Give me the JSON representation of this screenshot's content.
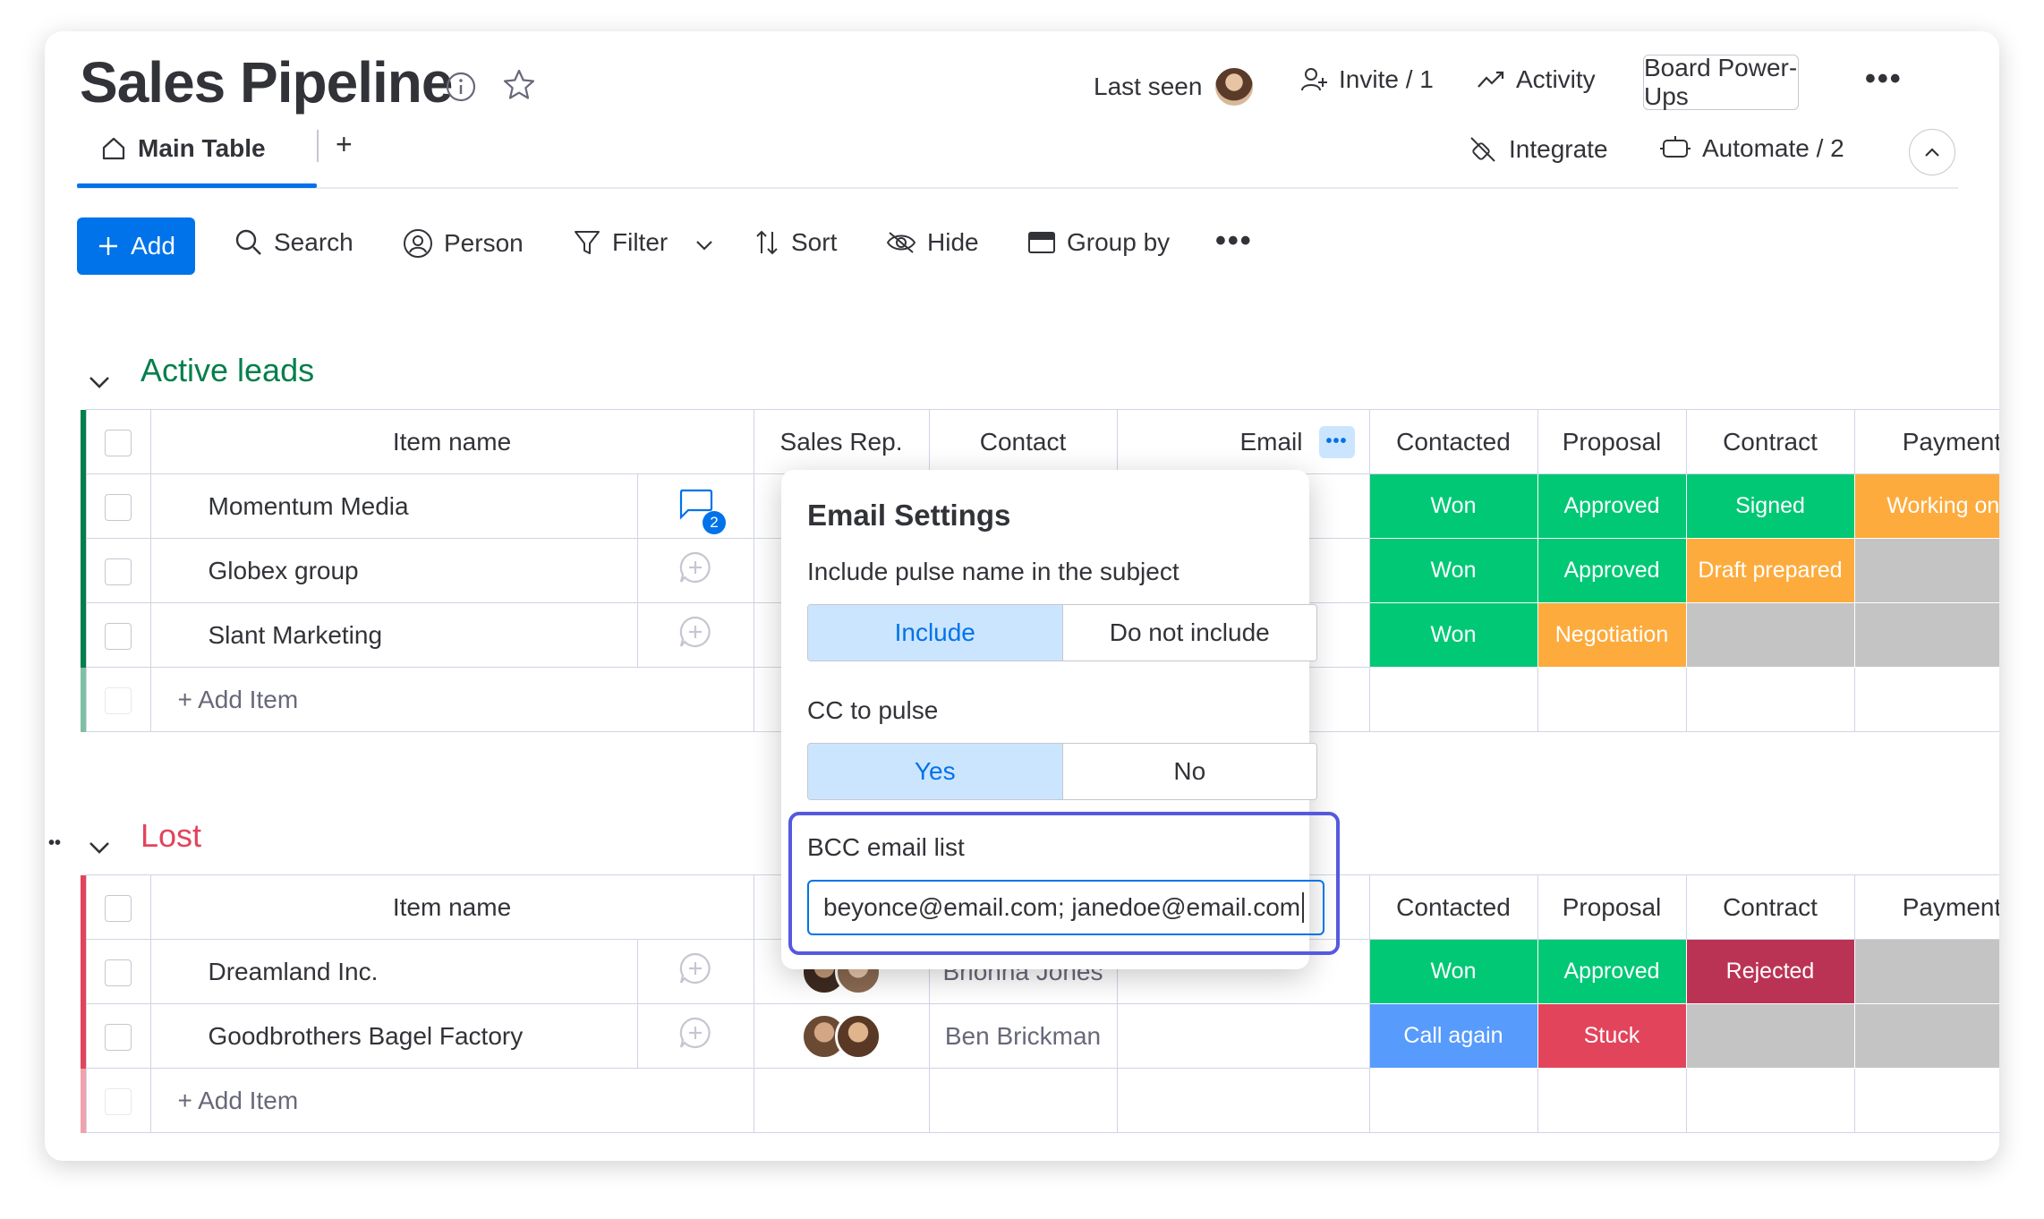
{
  "header": {
    "title": "Sales Pipeline",
    "last_seen": "Last seen",
    "invite": "Invite / 1",
    "activity": "Activity",
    "power_ups": "Board Power-Ups",
    "integrate": "Integrate",
    "automate": "Automate / 2"
  },
  "tabs": {
    "main": "Main Table",
    "add": "+"
  },
  "toolbar": {
    "add": "Add",
    "search": "Search",
    "person": "Person",
    "filter": "Filter",
    "sort": "Sort",
    "hide": "Hide",
    "group_by": "Group by"
  },
  "colors": {
    "accent": "#0073ea",
    "won": "#00c875",
    "orange": "#fdab3d",
    "empty": "#c4c4c4",
    "rejected": "#bb3354",
    "stuck": "#e2445c",
    "call_again": "#579bfc",
    "active_group": "#037f4c",
    "lost_group": "#e2445c"
  },
  "columns": {
    "item_name": "Item name",
    "sales_rep": "Sales Rep.",
    "contact": "Contact",
    "email": "Email",
    "contacted": "Contacted",
    "proposal": "Proposal",
    "contract": "Contract",
    "payment": "Payment"
  },
  "groups": {
    "active": {
      "title": "Active leads",
      "add_item": "+ Add Item",
      "rows": [
        {
          "name": "Momentum Media",
          "updates_count": "2",
          "contacted": "Won",
          "proposal": "Approved",
          "contract": "Signed",
          "payment": "Working on it"
        },
        {
          "name": "Globex group",
          "contacted": "Won",
          "proposal": "Approved",
          "contract": "Draft prepared",
          "payment": ""
        },
        {
          "name": "Slant Marketing",
          "contacted": "Won",
          "proposal": "Negotiation",
          "contract": "",
          "payment": ""
        }
      ]
    },
    "lost": {
      "title": "Lost",
      "add_item": "+ Add Item",
      "rows": [
        {
          "name": "Dreamland Inc.",
          "contact": "Brionna Jones",
          "contacted": "Won",
          "proposal": "Approved",
          "contract": "Rejected",
          "payment": ""
        },
        {
          "name": "Goodbrothers Bagel Factory",
          "contact": "Ben Brickman",
          "contacted": "Call again",
          "proposal": "Stuck",
          "contract": "",
          "payment": ""
        }
      ]
    }
  },
  "email_settings": {
    "title": "Email Settings",
    "include_label": "Include pulse name in the subject",
    "include": "Include",
    "do_not_include": "Do not include",
    "cc_label": "CC to pulse",
    "yes": "Yes",
    "no": "No",
    "bcc_label": "BCC email list",
    "bcc_value": "beyonce@email.com; janedoe@email.com"
  }
}
